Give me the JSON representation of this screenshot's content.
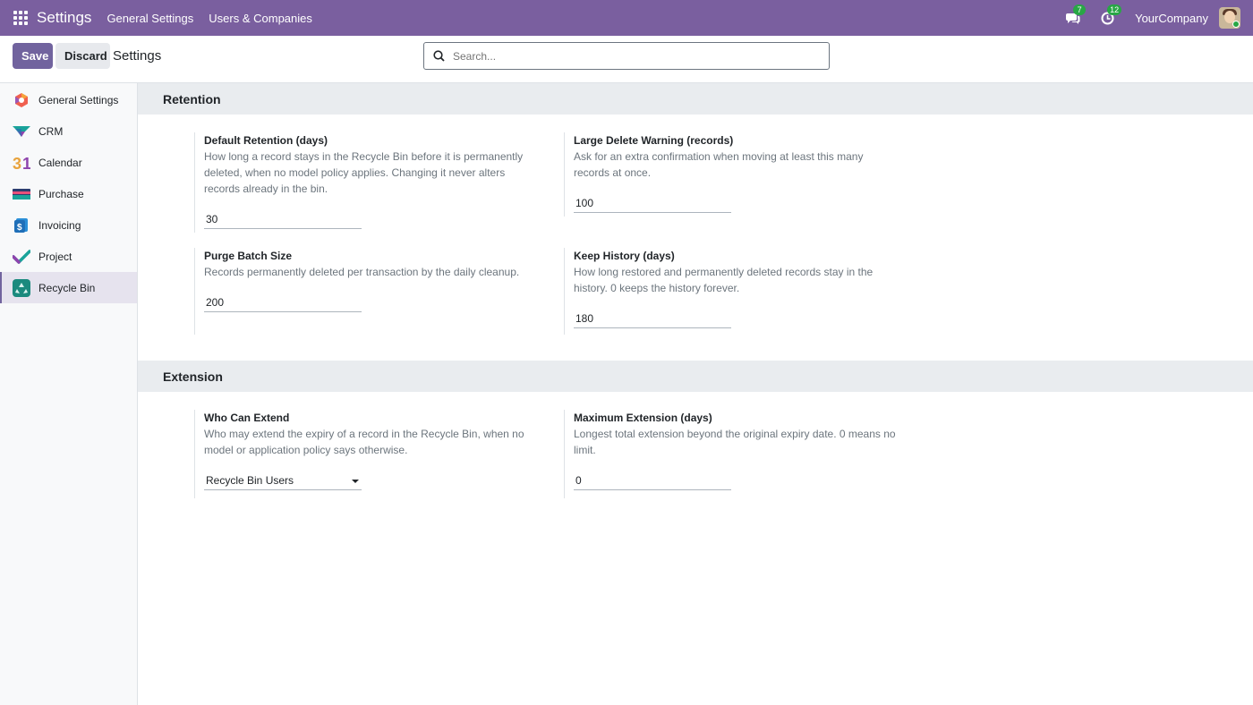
{
  "navbar": {
    "app_title": "Settings",
    "menu": [
      "General Settings",
      "Users & Companies"
    ],
    "messages_count": "7",
    "activities_count": "12",
    "company": "YourCompany"
  },
  "control": {
    "save_label": "Save",
    "discard_label": "Discard",
    "title": "Settings",
    "search_placeholder": "Search..."
  },
  "sidebar": {
    "items": [
      {
        "label": "General Settings",
        "icon": "settings-app-icon"
      },
      {
        "label": "CRM",
        "icon": "crm-app-icon"
      },
      {
        "label": "Calendar",
        "icon": "calendar-app-icon"
      },
      {
        "label": "Purchase",
        "icon": "purchase-app-icon"
      },
      {
        "label": "Invoicing",
        "icon": "invoicing-app-icon"
      },
      {
        "label": "Project",
        "icon": "project-app-icon"
      },
      {
        "label": "Recycle Bin",
        "icon": "recycle-bin-app-icon",
        "active": true
      }
    ]
  },
  "sections": {
    "retention": {
      "title": "Retention",
      "default_retention": {
        "label": "Default Retention (days)",
        "help": "How long a record stays in the Recycle Bin before it is permanently deleted, when no model policy applies. Changing it never alters records already in the bin.",
        "value": "30"
      },
      "large_delete": {
        "label": "Large Delete Warning (records)",
        "help": "Ask for an extra confirmation when moving at least this many records at once.",
        "value": "100"
      },
      "purge_batch": {
        "label": "Purge Batch Size",
        "help": "Records permanently deleted per transaction by the daily cleanup.",
        "value": "200"
      },
      "keep_history": {
        "label": "Keep History (days)",
        "help": "How long restored and permanently deleted records stay in the history. 0 keeps the history forever.",
        "value": "180"
      }
    },
    "extension": {
      "title": "Extension",
      "who_can_extend": {
        "label": "Who Can Extend",
        "help": "Who may extend the expiry of a record in the Recycle Bin, when no model or application policy says otherwise.",
        "value": "Recycle Bin Users"
      },
      "max_extension": {
        "label": "Maximum Extension (days)",
        "help": "Longest total extension beyond the original expiry date. 0 means no limit.",
        "value": "0"
      }
    }
  },
  "colors": {
    "navbar": "#7a5f9f",
    "primary": "#71639e",
    "section_bg": "#e9ecef"
  }
}
